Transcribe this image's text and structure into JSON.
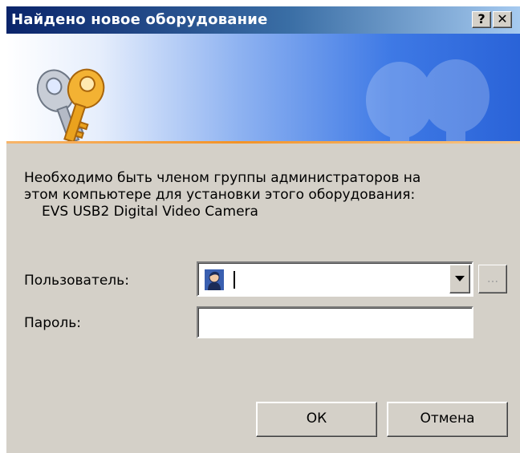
{
  "window": {
    "title": "Найдено новое оборудование",
    "help_glyph": "?",
    "close_glyph": "✕"
  },
  "message": {
    "line1": "Необходимо быть членом группы администраторов на",
    "line2": "этом компьютере для установки этого оборудования:",
    "device": "EVS USB2 Digital Video Camera"
  },
  "form": {
    "user_label": "Пользователь:",
    "user_value": "",
    "password_label": "Пароль:",
    "password_value": "",
    "browse_label": "..."
  },
  "buttons": {
    "ok": "ОК",
    "cancel": "Отмена"
  },
  "icons": {
    "banner": "keys-icon",
    "user": "user-avatar-icon",
    "dropdown": "chevron-down-icon"
  }
}
